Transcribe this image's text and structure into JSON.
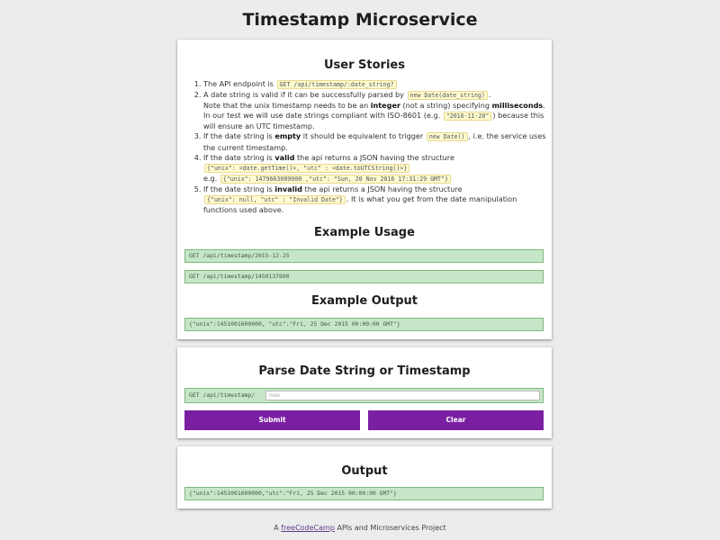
{
  "page_title": "Timestamp Microservice",
  "user_stories": {
    "heading": "User Stories",
    "s1": {
      "text": "The API endpoint is ",
      "code": "GET /api/timestamp/:date_string?"
    },
    "s2": {
      "a": "A date string is valid if it can be successfully parsed by ",
      "code": "new Date(date_string)",
      "b": ".",
      "c": "Note that the unix timestamp needs to be an ",
      "integer": "integer",
      "d": " (not a string) specifying ",
      "ms": "milliseconds",
      "e": ".",
      "f": "In our test we will use date strings compliant with ISO-8601 (e.g. ",
      "code2": "\"2016-11-20\"",
      "g": ") because this will ensure an UTC timestamp."
    },
    "s3": {
      "a": "If the date string is ",
      "empty": "empty",
      "b": " it should be equivalent to trigger ",
      "code": "new Date()",
      "c": ", i.e. the service uses the current timestamp."
    },
    "s4": {
      "a": "If the date string is ",
      "valid": "valid",
      "b": " the api returns a JSON having the structure",
      "code1": "{\"unix\": <date.getTime()>, \"utc\" : <date.toUTCString()>}",
      "eg": "e.g. ",
      "code2": "{\"unix\": 1479663089000 ,\"utc\": \"Sun, 20 Nov 2016 17:31:29 GMT\"}"
    },
    "s5": {
      "a": "If the date string is ",
      "invalid": "invalid",
      "b": " the api returns a JSON having the structure",
      "code": "{\"unix\": null, \"utc\" : \"Invalid Date\"}",
      "c": ". It is what you get from the date manipulation functions used above."
    }
  },
  "example_usage": {
    "heading": "Example Usage",
    "lines": [
      "GET /api/timestamp/2015-12-25",
      "GET /api/timestamp/1450137600"
    ]
  },
  "example_output": {
    "heading": "Example Output",
    "line": "{\"unix\":1451001600000, \"utc\":\"Fri, 25 Dec 2015 00:00:00 GMT\"}"
  },
  "parse_form": {
    "heading": "Parse Date String or Timestamp",
    "prefix": "GET /api/timestamp/",
    "input_value": "",
    "input_placeholder": "now",
    "submit_label": "Submit",
    "clear_label": "Clear"
  },
  "output": {
    "heading": "Output",
    "line": "{\"unix\":1451001600000,\"utc\":\"Fri, 25 Dec 2015 00:00:00 GMT\"}"
  },
  "footer": {
    "prefix": "A ",
    "link": "freeCodeCamp",
    "suffix": " APIs and Microservices Project"
  },
  "colors": {
    "button": "#7b1fa2",
    "code_bg": "#fffbd0",
    "green_box": "#c7e6c7",
    "page_bg": "#ececec"
  }
}
